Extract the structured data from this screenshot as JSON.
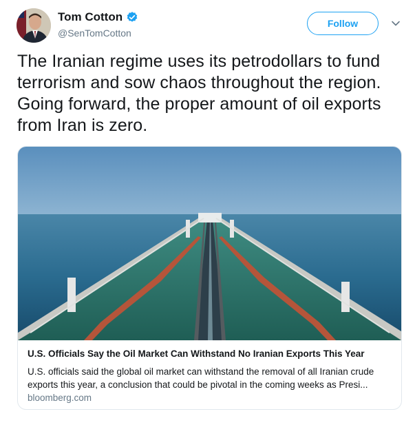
{
  "user": {
    "display_name": "Tom Cotton",
    "handle": "@SenTomCotton",
    "verified": true,
    "avatar_icon": "avatar-portrait"
  },
  "actions": {
    "follow_label": "Follow",
    "more_icon": "chevron-down-icon"
  },
  "tweet": {
    "text": "The Iranian regime uses its petrodollars to fund terrorism and sow chaos throughout the region. Going forward, the proper amount of oil exports from Iran is zero."
  },
  "card": {
    "image_icon": "oil-tanker-photo",
    "title": "U.S. Officials Say the Oil Market Can Withstand No Iranian Exports This Year",
    "description": "U.S. officials said the global oil market can withstand the removal of all Iranian crude exports this year, a conclusion that could be pivotal in the coming weeks as Presi...",
    "domain": "bloomberg.com"
  },
  "colors": {
    "accent": "#1da1f2",
    "secondary_text": "#657786",
    "border": "#e1e8ed"
  }
}
